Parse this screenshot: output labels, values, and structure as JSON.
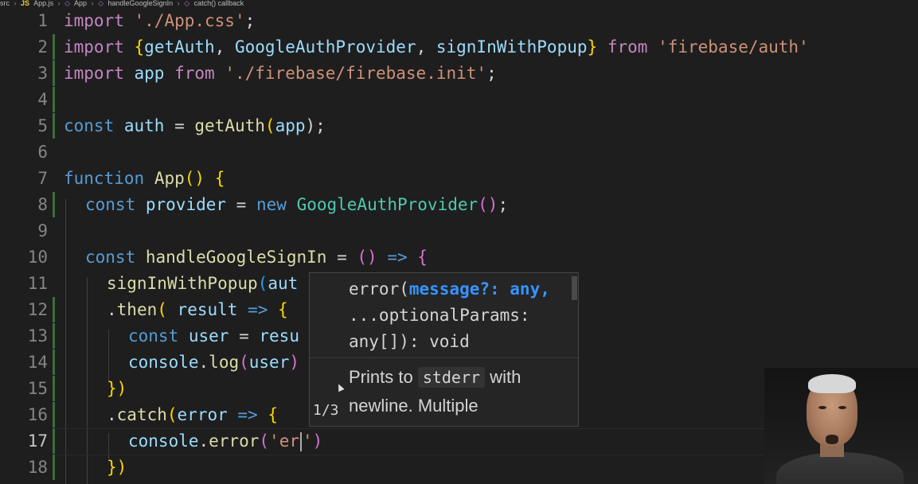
{
  "breadcrumb": [
    "src",
    "App.js",
    "App",
    "handleGoogleSignIn",
    "catch() callback"
  ],
  "editor": {
    "active_line": 17,
    "lines": [
      {
        "n": "1"
      },
      {
        "n": "2"
      },
      {
        "n": "3"
      },
      {
        "n": "4"
      },
      {
        "n": "5"
      },
      {
        "n": "6"
      },
      {
        "n": "7"
      },
      {
        "n": "8"
      },
      {
        "n": "9"
      },
      {
        "n": "10"
      },
      {
        "n": "11"
      },
      {
        "n": "12"
      },
      {
        "n": "13"
      },
      {
        "n": "14"
      },
      {
        "n": "15"
      },
      {
        "n": "16"
      },
      {
        "n": "17"
      },
      {
        "n": "18"
      }
    ],
    "tokens": {
      "l1": [
        "import",
        " ",
        "'./App.css'",
        ";"
      ],
      "l2": [
        "import",
        " ",
        "{",
        "getAuth",
        ", ",
        "GoogleAuthProvider",
        ", ",
        "signInWithPopup",
        "}",
        " ",
        "from",
        " ",
        "'firebase/auth'"
      ],
      "l3": [
        "import",
        " ",
        "app",
        " ",
        "from",
        " ",
        "'./firebase/firebase.init'",
        ";"
      ],
      "l5": [
        "const",
        " ",
        "auth",
        " = ",
        "getAuth",
        "(",
        "app",
        ");"
      ],
      "l7": [
        "function",
        " ",
        "App",
        "()",
        " ",
        "{"
      ],
      "l8": [
        "const",
        " ",
        "provider",
        " = ",
        "new",
        " ",
        "GoogleAuthProvider",
        "()",
        ";"
      ],
      "l10": [
        "const",
        " ",
        "handleGoogleSignIn",
        " = ",
        "()",
        " ",
        "=>",
        " ",
        "{"
      ],
      "l11": [
        "signInWithPopup",
        "(",
        "aut"
      ],
      "l12": [
        ".",
        "then",
        "(",
        " ",
        "result",
        " ",
        "=>",
        " ",
        "{"
      ],
      "l13": [
        "const",
        " ",
        "user",
        " = ",
        "resu"
      ],
      "l14": [
        "console",
        ".",
        "log",
        "(",
        "user",
        ")"
      ],
      "l15": [
        "}",
        ")"
      ],
      "l16": [
        ".",
        "catch",
        "(",
        "error",
        " ",
        "=>",
        " ",
        "{"
      ],
      "l17": [
        "console",
        ".",
        "error",
        "(",
        "'er",
        "'",
        ")"
      ],
      "l18": [
        "}",
        ")"
      ]
    }
  },
  "hover": {
    "sig_prefix": "error(",
    "sig_param": "message?: any,",
    "sig_rest": "...optionalParams: any[]): void",
    "doc_text_1": "Prints to ",
    "doc_code": "stderr",
    "doc_text_2": " with newline. Multiple",
    "counter": "1/3"
  },
  "icons": {
    "breadcrumb_js": "js-file-icon",
    "breadcrumb_symbol": "symbol-icon"
  },
  "colors": {
    "background": "#1e1e1e",
    "keyword": "#c586c0",
    "keyword_blue": "#569cd6",
    "string": "#ce9178",
    "function": "#dcdcaa",
    "variable": "#9cdcfe",
    "class": "#4ec9b0",
    "hover_highlight": "#3794ff"
  }
}
